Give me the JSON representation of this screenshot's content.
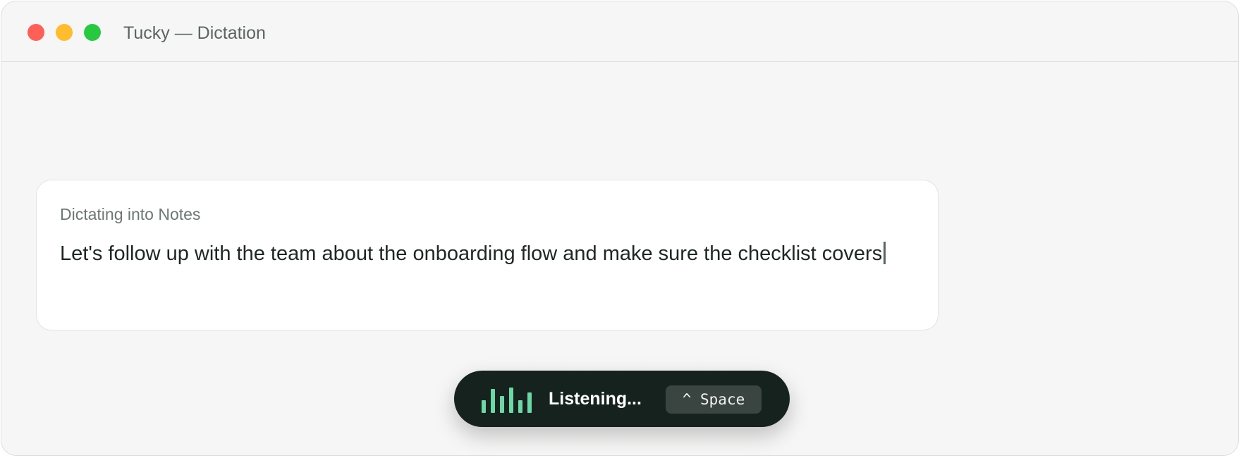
{
  "window": {
    "title": "Tucky — Dictation"
  },
  "traffic_lights": {
    "close_color": "#fe5f57",
    "minimize_color": "#febc2e",
    "maximize_color": "#28c840"
  },
  "card": {
    "label": "Dictating into Notes",
    "text": "Let's follow up with the team about the onboarding flow and make sure the checklist covers",
    "caret_color": "#596561"
  },
  "indicator": {
    "status": "Listening...",
    "shortcut": "^ Space",
    "background_color": "#15221e",
    "waveform_color": "#6ed7a6",
    "waveform_levels": [
      0.45,
      0.85,
      0.6,
      0.9,
      0.45,
      0.72
    ]
  }
}
